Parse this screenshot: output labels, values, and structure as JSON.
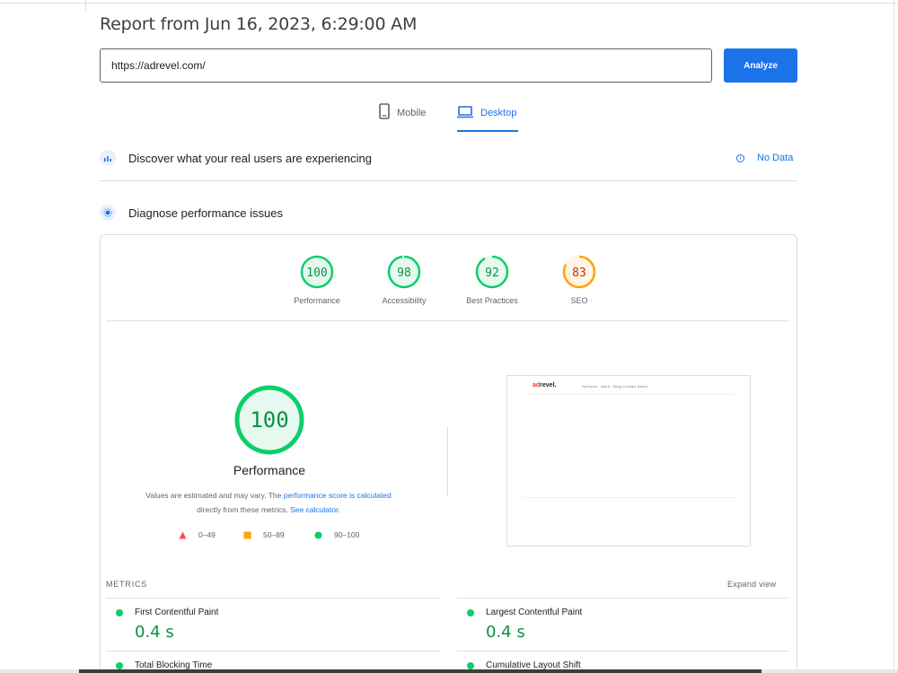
{
  "report": {
    "title": "Report from Jun 16, 2023, 6:29:00 AM"
  },
  "search": {
    "url": "https://adrevel.com/",
    "analyze_label": "Analyze"
  },
  "tabs": [
    {
      "label": "Mobile",
      "icon": "phone-icon",
      "active": false
    },
    {
      "label": "Desktop",
      "icon": "laptop-icon",
      "active": true
    }
  ],
  "sections": {
    "discover": {
      "label": "Discover what your real users are experiencing",
      "status": "No Data"
    },
    "diagnose": {
      "label": "Diagnose performance issues"
    }
  },
  "scores": [
    {
      "value": "100",
      "label": "Performance",
      "color": "#0cce6b"
    },
    {
      "value": "98",
      "label": "Accessibility",
      "color": "#0cce6b"
    },
    {
      "value": "92",
      "label": "Best Practices",
      "color": "#0cce6b"
    },
    {
      "value": "83",
      "label": "SEO",
      "color": "#ffa400"
    }
  ],
  "performance": {
    "score": "100",
    "title": "Performance",
    "note_prefix": "Values are estimated and may vary. The ",
    "note_link": "performance score is calculated",
    "note_mid": "directly from these metrics. ",
    "note_link2": "See calculator."
  },
  "legend": [
    {
      "range": "0–49",
      "shape": "triangle",
      "color": "#ff4e42"
    },
    {
      "range": "50–89",
      "shape": "square",
      "color": "#ffa400"
    },
    {
      "range": "90–100",
      "shape": "circle",
      "color": "#0cce6b"
    }
  ],
  "screenshot": {
    "logo_red": "ad",
    "logo_rest": "revel.",
    "nav": "Services ·  Work ·  Blog   Contact   About"
  },
  "metrics": {
    "label": "METRICS",
    "expand": "Expand view",
    "items": [
      {
        "name": "First Contentful Paint",
        "value": "0.4 s"
      },
      {
        "name": "Largest Contentful Paint",
        "value": "0.4 s"
      },
      {
        "name": "Total Blocking Time",
        "value": ""
      },
      {
        "name": "Cumulative Layout Shift",
        "value": ""
      }
    ]
  },
  "colors": {
    "accent": "#1a73e8",
    "good": "#0cce6b",
    "good_text": "#0d8f47",
    "average": "#ffa400",
    "poor": "#ff4e42"
  }
}
